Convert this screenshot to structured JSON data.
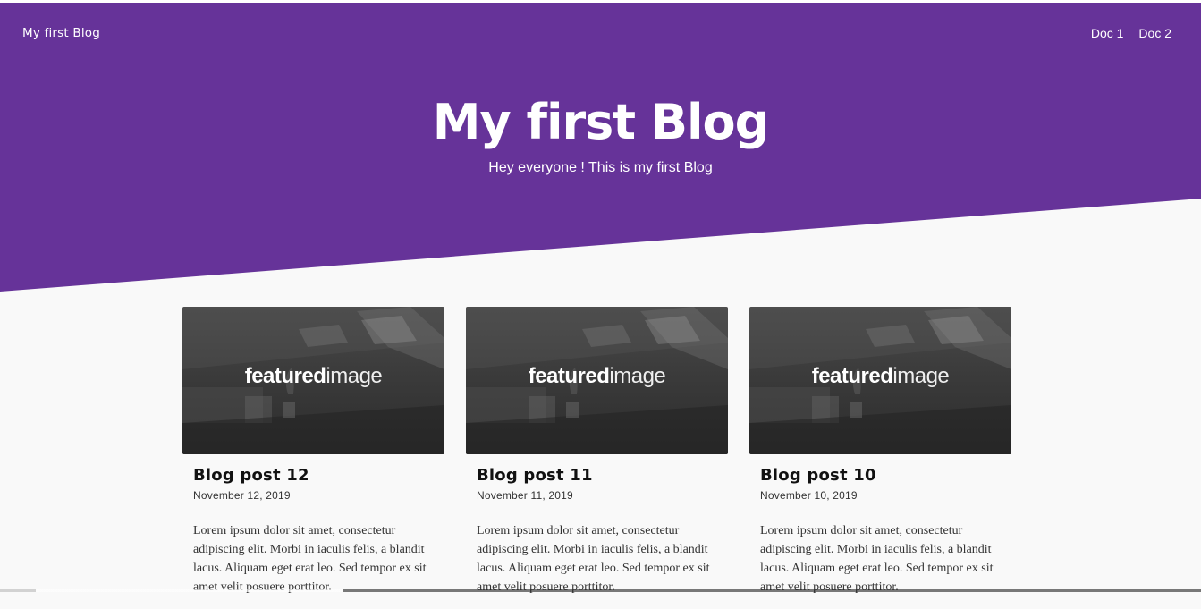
{
  "site": {
    "title": "My first Blog"
  },
  "nav": {
    "items": [
      {
        "label": "Doc 1"
      },
      {
        "label": "Doc 2"
      }
    ]
  },
  "hero": {
    "title": "My first Blog",
    "subtitle": "Hey everyone ! This is my first Blog",
    "color": "#663399"
  },
  "featured_image": {
    "bold": "featured",
    "light": "image"
  },
  "posts": [
    {
      "title": "Blog post 12",
      "date": "November 12, 2019",
      "excerpt": "Lorem ipsum dolor sit amet, consectetur adipiscing elit. Morbi in iaculis felis, a blandit lacus. Aliquam eget erat leo. Sed tempor ex sit amet velit posuere porttitor."
    },
    {
      "title": "Blog post 11",
      "date": "November 11, 2019",
      "excerpt": "Lorem ipsum dolor sit amet, consectetur adipiscing elit. Morbi in iaculis felis, a blandit lacus. Aliquam eget erat leo. Sed tempor ex sit amet velit posuere porttitor."
    },
    {
      "title": "Blog post 10",
      "date": "November 10, 2019",
      "excerpt": "Lorem ipsum dolor sit amet, consectetur adipiscing elit. Morbi in iaculis felis, a blandit lacus. Aliquam eget erat leo. Sed tempor ex sit amet velit posuere porttitor."
    }
  ]
}
